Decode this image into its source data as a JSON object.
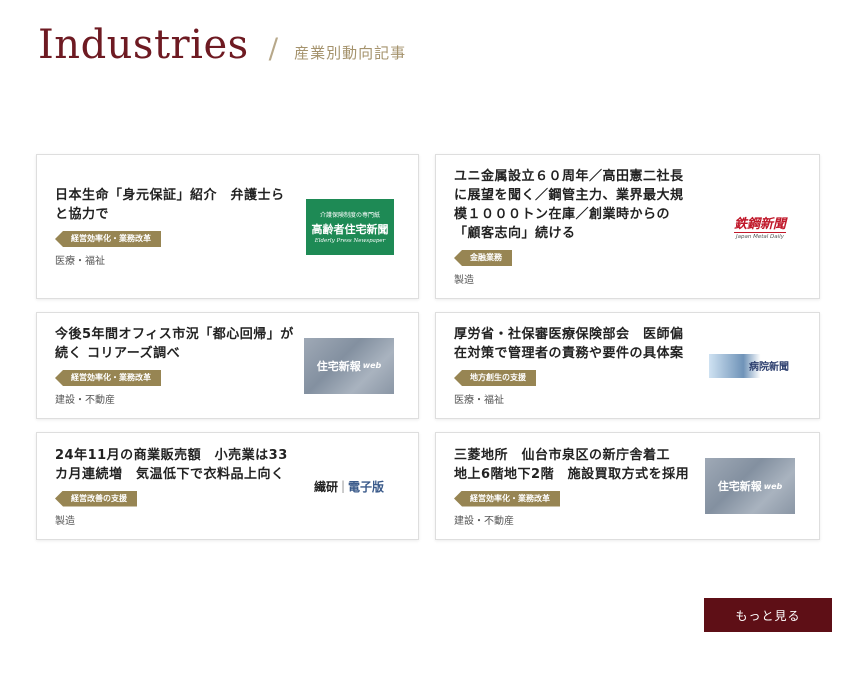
{
  "header": {
    "title": "Industries",
    "slash": "/",
    "subtitle": "産業別動向記事"
  },
  "articles": [
    {
      "headline": "日本生命「身元保証」紹介　弁護士らと協力で",
      "tag": "経営効率化・業務改革",
      "category": "医療・福祉",
      "thumb": {
        "kind": "koreisha",
        "line1": "介護保険制度の専門紙",
        "line2": "高齢者住宅新聞",
        "line3": "Elderly Press Newspaper"
      }
    },
    {
      "headline": "ユニ金属設立６０周年／高田憲二社長に展望を聞く／鋼管主力、業界最大規模１０００トン在庫／創業時からの「顧客志向」続ける",
      "tag": "金融業務",
      "category": "製造",
      "thumb": {
        "kind": "tekko",
        "line1": "鉄鋼新聞",
        "line2": "Japan Metal Daily"
      }
    },
    {
      "headline": "今後5年間オフィス市況「都心回帰」が続く コリアーズ調べ",
      "tag": "経営効率化・業務改革",
      "category": "建設・不動産",
      "thumb": {
        "kind": "jutaku",
        "line1": "住宅新報",
        "line2": "web"
      }
    },
    {
      "headline": "厚労省・社保審医療保険部会　医師偏在対策で管理者の責務や要件の具体案",
      "tag": "地方創生の支援",
      "category": "医療・福祉",
      "thumb": {
        "kind": "byoin",
        "line1": "病院新聞"
      }
    },
    {
      "headline": "24年11月の商業販売額　小売業は33カ月連続増　気温低下で衣料品上向く",
      "tag": "経営改善の支援",
      "category": "製造",
      "thumb": {
        "kind": "senken",
        "line1": "繊研",
        "sep": "|",
        "line2": "電子版"
      }
    },
    {
      "headline": "三菱地所　仙台市泉区の新庁舎着工　地上6階地下2階　施設買取方式を採用",
      "tag": "経営効率化・業務改革",
      "category": "建設・不動産",
      "thumb": {
        "kind": "jutaku",
        "line1": "住宅新報",
        "line2": "web"
      }
    }
  ],
  "more_button": "もっと見る",
  "colors": {
    "title": "#6e1a22",
    "tag_bg": "#978553",
    "button_bg": "#5e0f16"
  }
}
